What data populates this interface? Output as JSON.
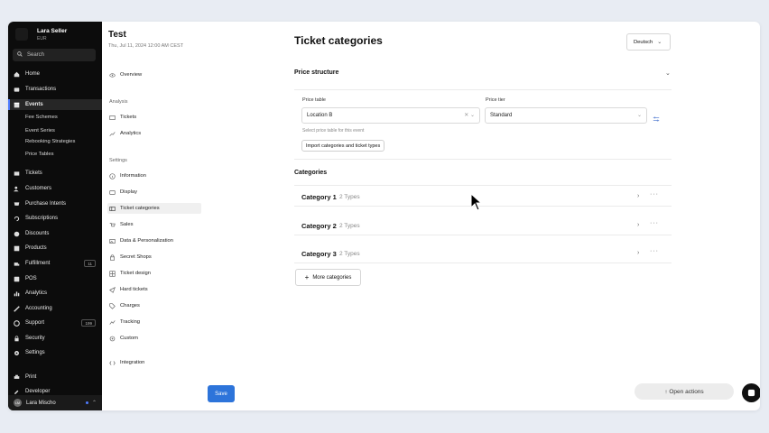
{
  "org": {
    "name": "Lara Seller",
    "currency": "EUR"
  },
  "sidebar": {
    "search_placeholder": "Search",
    "items": [
      {
        "label": "Home",
        "icon": "home-icon"
      },
      {
        "label": "Transactions",
        "icon": "transactions-icon"
      },
      {
        "label": "Events",
        "icon": "events-icon",
        "active": true
      },
      {
        "label": "Tickets",
        "icon": "tickets-icon"
      },
      {
        "label": "Customers",
        "icon": "customers-icon"
      },
      {
        "label": "Purchase Intents",
        "icon": "purchase-intents-icon"
      },
      {
        "label": "Subscriptions",
        "icon": "subscriptions-icon"
      },
      {
        "label": "Discounts",
        "icon": "discounts-icon"
      },
      {
        "label": "Products",
        "icon": "products-icon"
      },
      {
        "label": "Fulfillment",
        "icon": "fulfillment-icon",
        "badge": "11"
      },
      {
        "label": "POS",
        "icon": "pos-icon"
      },
      {
        "label": "Analytics",
        "icon": "analytics-icon"
      },
      {
        "label": "Accounting",
        "icon": "accounting-icon"
      },
      {
        "label": "Support",
        "icon": "support-icon",
        "badge": "199"
      },
      {
        "label": "Security",
        "icon": "security-icon"
      },
      {
        "label": "Settings",
        "icon": "settings-icon"
      },
      {
        "label": "Print",
        "icon": "print-icon"
      },
      {
        "label": "Developer",
        "icon": "developer-icon"
      }
    ],
    "sub_items": [
      "Fee Schemes",
      "Event Series",
      "Rebooking Strategies",
      "Price Tables"
    ],
    "user": {
      "name": "Lara Mischo",
      "initials": "LM"
    }
  },
  "event": {
    "title": "Test",
    "date": "Thu, Jul 11, 2024 12:00 AM CEST",
    "overview_label": "Overview",
    "analysis_section": "Analysis",
    "analysis_items": [
      "Tickets",
      "Analytics"
    ],
    "settings_section": "Settings",
    "settings_items": [
      "Information",
      "Display",
      "Ticket categories",
      "Sales",
      "Data & Personalization",
      "Secret Shops",
      "Ticket design",
      "Hard tickets",
      "Charges",
      "Tracking",
      "Custom"
    ],
    "integration_label": "Integration",
    "save_label": "Save"
  },
  "main": {
    "page_title": "Ticket categories",
    "language": "Deutsch",
    "price_structure": {
      "heading": "Price structure",
      "price_table_label": "Price table",
      "price_table_value": "Location B",
      "price_tier_label": "Price tier",
      "price_tier_value": "Standard",
      "hint": "Select price table for this event",
      "import_label": "Import categories and ticket types"
    },
    "categories_heading": "Categories",
    "categories": [
      {
        "name": "Category 1",
        "types": "2 Types"
      },
      {
        "name": "Category 2",
        "types": "2 Types"
      },
      {
        "name": "Category 3",
        "types": "2 Types"
      }
    ],
    "more_categories_label": "More categories",
    "open_actions_label": "↑ Open actions"
  },
  "colors": {
    "accent": "#2d74da",
    "sidebar_bg": "#0c0c0c"
  }
}
